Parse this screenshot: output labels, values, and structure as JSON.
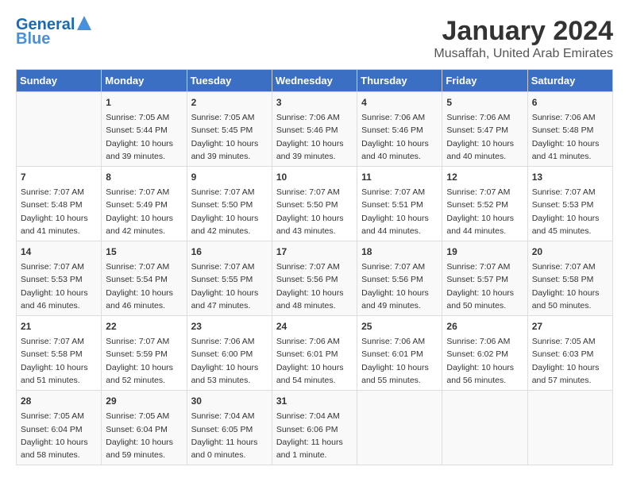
{
  "header": {
    "logo_line1": "General",
    "logo_line2": "Blue",
    "month": "January 2024",
    "location": "Musaffah, United Arab Emirates"
  },
  "days_of_week": [
    "Sunday",
    "Monday",
    "Tuesday",
    "Wednesday",
    "Thursday",
    "Friday",
    "Saturday"
  ],
  "weeks": [
    [
      {
        "day": "",
        "info": ""
      },
      {
        "day": "1",
        "info": "Sunrise: 7:05 AM\nSunset: 5:44 PM\nDaylight: 10 hours\nand 39 minutes."
      },
      {
        "day": "2",
        "info": "Sunrise: 7:05 AM\nSunset: 5:45 PM\nDaylight: 10 hours\nand 39 minutes."
      },
      {
        "day": "3",
        "info": "Sunrise: 7:06 AM\nSunset: 5:46 PM\nDaylight: 10 hours\nand 39 minutes."
      },
      {
        "day": "4",
        "info": "Sunrise: 7:06 AM\nSunset: 5:46 PM\nDaylight: 10 hours\nand 40 minutes."
      },
      {
        "day": "5",
        "info": "Sunrise: 7:06 AM\nSunset: 5:47 PM\nDaylight: 10 hours\nand 40 minutes."
      },
      {
        "day": "6",
        "info": "Sunrise: 7:06 AM\nSunset: 5:48 PM\nDaylight: 10 hours\nand 41 minutes."
      }
    ],
    [
      {
        "day": "7",
        "info": "Sunrise: 7:07 AM\nSunset: 5:48 PM\nDaylight: 10 hours\nand 41 minutes."
      },
      {
        "day": "8",
        "info": "Sunrise: 7:07 AM\nSunset: 5:49 PM\nDaylight: 10 hours\nand 42 minutes."
      },
      {
        "day": "9",
        "info": "Sunrise: 7:07 AM\nSunset: 5:50 PM\nDaylight: 10 hours\nand 42 minutes."
      },
      {
        "day": "10",
        "info": "Sunrise: 7:07 AM\nSunset: 5:50 PM\nDaylight: 10 hours\nand 43 minutes."
      },
      {
        "day": "11",
        "info": "Sunrise: 7:07 AM\nSunset: 5:51 PM\nDaylight: 10 hours\nand 44 minutes."
      },
      {
        "day": "12",
        "info": "Sunrise: 7:07 AM\nSunset: 5:52 PM\nDaylight: 10 hours\nand 44 minutes."
      },
      {
        "day": "13",
        "info": "Sunrise: 7:07 AM\nSunset: 5:53 PM\nDaylight: 10 hours\nand 45 minutes."
      }
    ],
    [
      {
        "day": "14",
        "info": "Sunrise: 7:07 AM\nSunset: 5:53 PM\nDaylight: 10 hours\nand 46 minutes."
      },
      {
        "day": "15",
        "info": "Sunrise: 7:07 AM\nSunset: 5:54 PM\nDaylight: 10 hours\nand 46 minutes."
      },
      {
        "day": "16",
        "info": "Sunrise: 7:07 AM\nSunset: 5:55 PM\nDaylight: 10 hours\nand 47 minutes."
      },
      {
        "day": "17",
        "info": "Sunrise: 7:07 AM\nSunset: 5:56 PM\nDaylight: 10 hours\nand 48 minutes."
      },
      {
        "day": "18",
        "info": "Sunrise: 7:07 AM\nSunset: 5:56 PM\nDaylight: 10 hours\nand 49 minutes."
      },
      {
        "day": "19",
        "info": "Sunrise: 7:07 AM\nSunset: 5:57 PM\nDaylight: 10 hours\nand 50 minutes."
      },
      {
        "day": "20",
        "info": "Sunrise: 7:07 AM\nSunset: 5:58 PM\nDaylight: 10 hours\nand 50 minutes."
      }
    ],
    [
      {
        "day": "21",
        "info": "Sunrise: 7:07 AM\nSunset: 5:58 PM\nDaylight: 10 hours\nand 51 minutes."
      },
      {
        "day": "22",
        "info": "Sunrise: 7:07 AM\nSunset: 5:59 PM\nDaylight: 10 hours\nand 52 minutes."
      },
      {
        "day": "23",
        "info": "Sunrise: 7:06 AM\nSunset: 6:00 PM\nDaylight: 10 hours\nand 53 minutes."
      },
      {
        "day": "24",
        "info": "Sunrise: 7:06 AM\nSunset: 6:01 PM\nDaylight: 10 hours\nand 54 minutes."
      },
      {
        "day": "25",
        "info": "Sunrise: 7:06 AM\nSunset: 6:01 PM\nDaylight: 10 hours\nand 55 minutes."
      },
      {
        "day": "26",
        "info": "Sunrise: 7:06 AM\nSunset: 6:02 PM\nDaylight: 10 hours\nand 56 minutes."
      },
      {
        "day": "27",
        "info": "Sunrise: 7:05 AM\nSunset: 6:03 PM\nDaylight: 10 hours\nand 57 minutes."
      }
    ],
    [
      {
        "day": "28",
        "info": "Sunrise: 7:05 AM\nSunset: 6:04 PM\nDaylight: 10 hours\nand 58 minutes."
      },
      {
        "day": "29",
        "info": "Sunrise: 7:05 AM\nSunset: 6:04 PM\nDaylight: 10 hours\nand 59 minutes."
      },
      {
        "day": "30",
        "info": "Sunrise: 7:04 AM\nSunset: 6:05 PM\nDaylight: 11 hours\nand 0 minutes."
      },
      {
        "day": "31",
        "info": "Sunrise: 7:04 AM\nSunset: 6:06 PM\nDaylight: 11 hours\nand 1 minute."
      },
      {
        "day": "",
        "info": ""
      },
      {
        "day": "",
        "info": ""
      },
      {
        "day": "",
        "info": ""
      }
    ]
  ]
}
